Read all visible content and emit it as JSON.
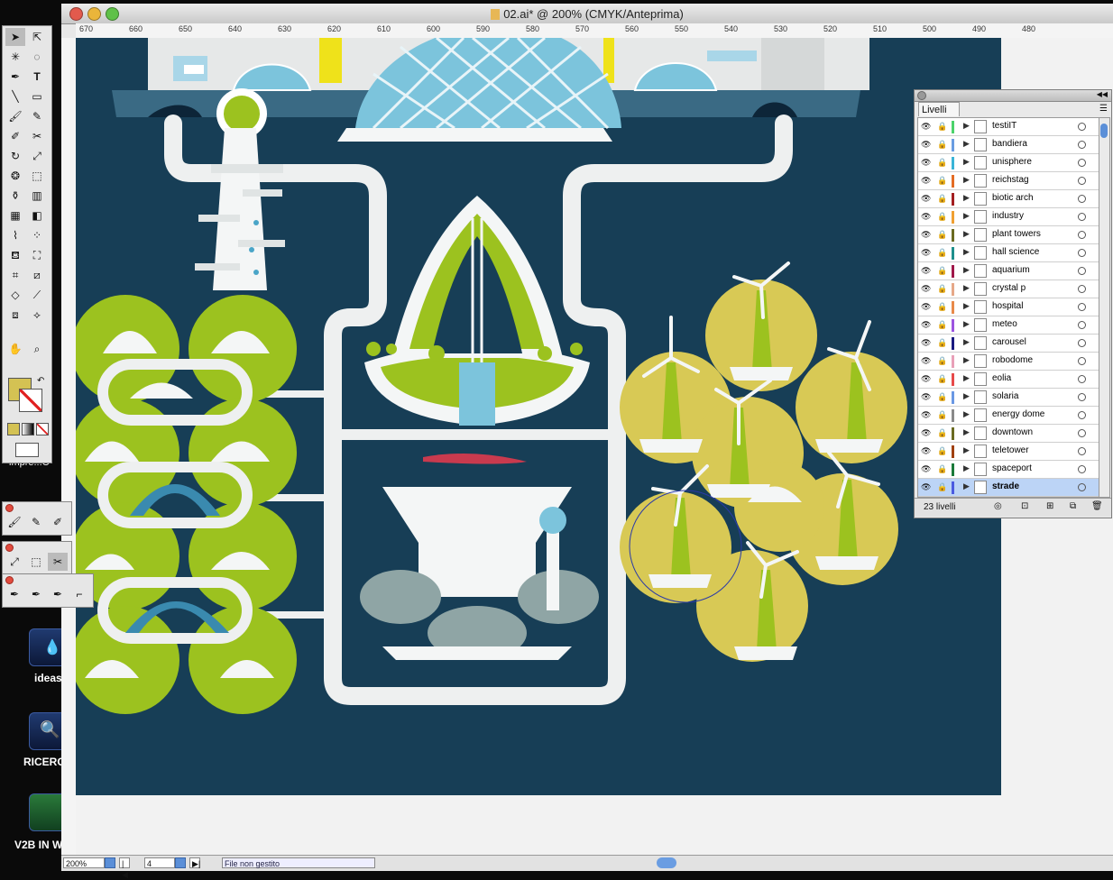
{
  "window": {
    "title": "02.ai* @ 200% (CMYK/Anteprima)",
    "ruler_ticks": [
      "670",
      "660",
      "650",
      "640",
      "630",
      "620",
      "610",
      "600",
      "590",
      "580",
      "570",
      "560",
      "550",
      "540",
      "530",
      "520",
      "510",
      "500",
      "490",
      "480"
    ]
  },
  "desktop": {
    "icons": [
      {
        "label": "impre...C",
        "icon": "disk-icon"
      },
      {
        "label": "ideas",
        "icon": "drop-icon"
      },
      {
        "label": "RICERC",
        "icon": "magnifier-icon"
      },
      {
        "label": "V2B IN W",
        "icon": "archive-icon"
      }
    ]
  },
  "status": {
    "zoom": "200%",
    "page": "4",
    "info": "File non gestito"
  },
  "colors": {
    "artboard": "#173e56",
    "green": "#9cc21f",
    "mustard": "#d8c955",
    "light_blue": "#7cc4dc",
    "white": "#f4f6f6",
    "red": "#c93a4e",
    "fill_swatch": "#d4c253"
  },
  "layers_panel": {
    "tab": "Livelli",
    "count_label": "23 livelli",
    "layers": [
      {
        "name": "testiIT",
        "color": "#4cd36b"
      },
      {
        "name": "bandiera",
        "color": "#6a9de2"
      },
      {
        "name": "unisphere",
        "color": "#3ab4d7"
      },
      {
        "name": "reichstag",
        "color": "#e46c24"
      },
      {
        "name": "biotic arch",
        "color": "#a31e20"
      },
      {
        "name": "industry",
        "color": "#f0a032"
      },
      {
        "name": "plant towers",
        "color": "#6b6b21"
      },
      {
        "name": "hall science",
        "color": "#1f8f8c"
      },
      {
        "name": "aquarium",
        "color": "#a0184a"
      },
      {
        "name": "crystal p",
        "color": "#e6a888"
      },
      {
        "name": "hospital",
        "color": "#e88a4a"
      },
      {
        "name": "meteo",
        "color": "#9d54e0"
      },
      {
        "name": "carousel",
        "color": "#1a1a80"
      },
      {
        "name": "robodome",
        "color": "#e8a0b8"
      },
      {
        "name": "eolia",
        "color": "#e74a4a"
      },
      {
        "name": "solaria",
        "color": "#6a98e4"
      },
      {
        "name": "energy dome",
        "color": "#8a8a8a"
      },
      {
        "name": "downtown",
        "color": "#6b6b21"
      },
      {
        "name": "teletower",
        "color": "#a04010"
      },
      {
        "name": "spaceport",
        "color": "#1a7a3a"
      },
      {
        "name": "strade",
        "color": "#4a5ae0"
      }
    ]
  }
}
